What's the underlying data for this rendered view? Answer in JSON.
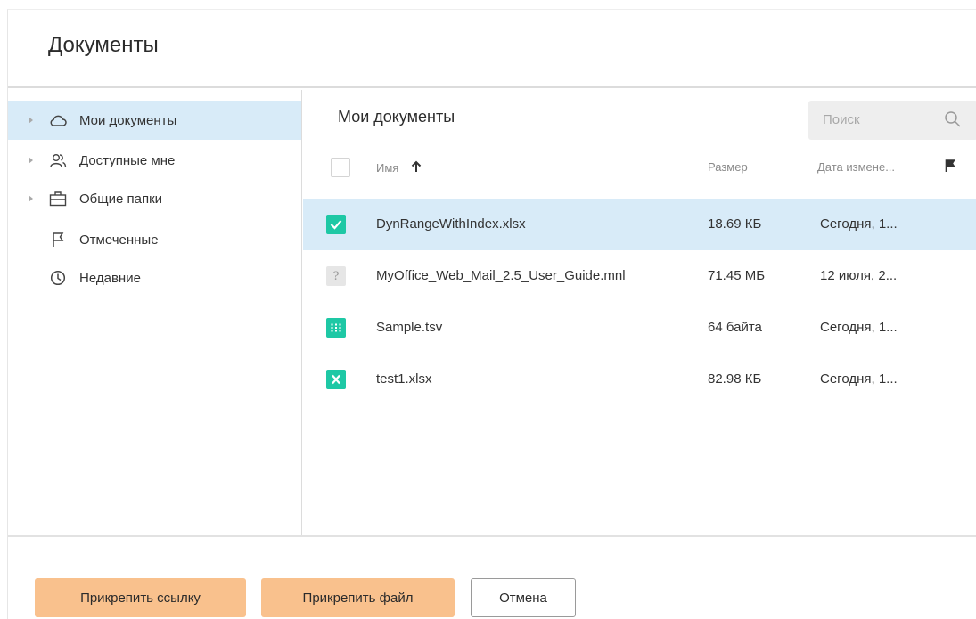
{
  "dialog": {
    "title": "Документы"
  },
  "sidebar": {
    "items": [
      {
        "label": "Мои документы",
        "icon": "cloud-icon",
        "expandable": true,
        "active": true
      },
      {
        "label": "Доступные мне",
        "icon": "users-icon",
        "expandable": true,
        "active": false
      },
      {
        "label": "Общие папки",
        "icon": "briefcase-icon",
        "expandable": true,
        "active": false
      },
      {
        "label": "Отмеченные",
        "icon": "flag-icon",
        "expandable": false,
        "active": false
      },
      {
        "label": "Недавние",
        "icon": "clock-icon",
        "expandable": false,
        "active": false
      }
    ]
  },
  "main": {
    "title": "Мои документы",
    "search": {
      "placeholder": "Поиск"
    },
    "columns": {
      "name": "Имя",
      "size": "Размер",
      "date": "Дата измене..."
    },
    "files": [
      {
        "name": "DynRangeWithIndex.xlsx",
        "size": "18.69 КБ",
        "date": "Сегодня, 1...",
        "icon": "checkbox-checked-icon",
        "selected": true
      },
      {
        "name": "MyOffice_Web_Mail_2.5_User_Guide.mnl",
        "size": "71.45 МБ",
        "date": "12 июля, 2...",
        "icon": "unknown-file-icon",
        "selected": false
      },
      {
        "name": "Sample.tsv",
        "size": "64 байта",
        "date": "Сегодня, 1...",
        "icon": "tsv-file-icon",
        "selected": false
      },
      {
        "name": "test1.xlsx",
        "size": "82.98 КБ",
        "date": "Сегодня, 1...",
        "icon": "xlsx-file-icon",
        "selected": false
      }
    ]
  },
  "footer": {
    "attach_link_label": "Прикрепить ссылку",
    "attach_file_label": "Прикрепить файл",
    "cancel_label": "Отмена"
  },
  "colors": {
    "accent_button": "#f9c18d",
    "selection": "#d8ebf8",
    "file_green": "#1ec8a5"
  }
}
